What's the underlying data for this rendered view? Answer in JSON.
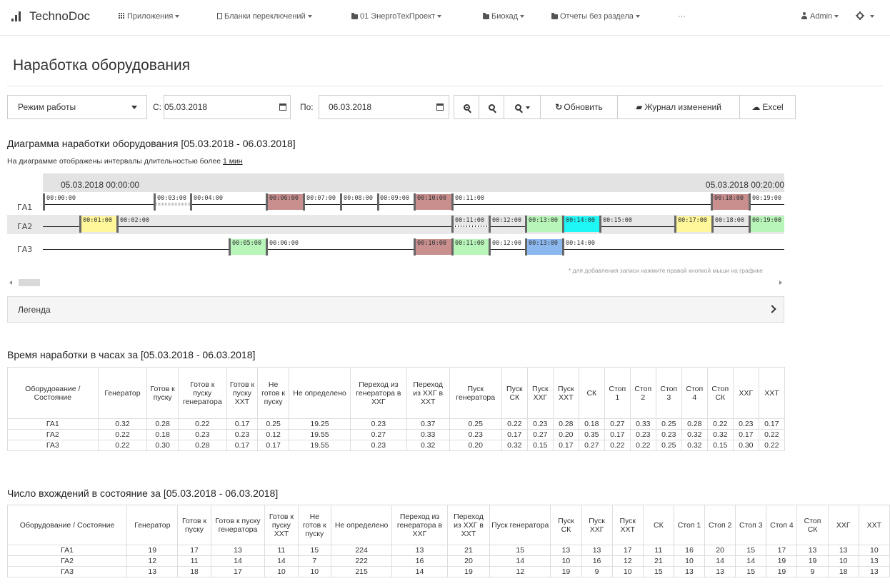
{
  "app": {
    "brand": "TechnoDoc",
    "nav": [
      {
        "label": "Приложения",
        "icon": "grid-icon"
      },
      {
        "label": "Бланки переключений",
        "icon": "document-icon"
      },
      {
        "label": "01 ЭнергоТехПроект",
        "icon": "folder-icon"
      },
      {
        "label": "Биокад",
        "icon": "folder-icon"
      },
      {
        "label": "Отчеты без раздела",
        "icon": "folder-icon"
      },
      {
        "label": "···",
        "icon": ""
      }
    ],
    "user": "Admin"
  },
  "page": {
    "title": "Наработка оборудования"
  },
  "toolbar": {
    "mode_select": "Режим работы",
    "from_label": "С:",
    "from_value": "05.03.2018",
    "to_label": "По:",
    "to_value": "06.03.2018",
    "refresh": "Обновить",
    "changelog": "Журнал изменений",
    "excel": "Excel"
  },
  "diagram": {
    "title": "Диаграмма наработки оборудования [05.03.2018 - 06.03.2018]",
    "note_prefix": "На диаграмме отображены интервалы длительностью более ",
    "note_link": "1 мин",
    "range_start": "05.03.2018 00:00:00",
    "range_end": "05.03.2018 00:20:00",
    "hint": "* для добавления записи нажмите правой кнопкой мыши на графике",
    "rows": [
      {
        "label": "ГА1"
      },
      {
        "label": "ГА2"
      },
      {
        "label": "ГА3"
      }
    ],
    "times": {
      "r1": [
        "00:00:00",
        "00:03:00",
        "00:04:00",
        "00:06:00",
        "00:07:00",
        "00:08:00",
        "00:09:00",
        "00:10:00",
        "00:11:00",
        "00:18:00",
        "00:19:00"
      ],
      "r2": [
        "00:01:00",
        "00:02:00",
        "00:11:00",
        "00:12:00",
        "00:13:00",
        "00:14:00",
        "00:15:00",
        "00:17:00",
        "00:18:00",
        "00:19:00"
      ],
      "r3": [
        "00:05:00",
        "00:06:00",
        "00:10:00",
        "00:11:00",
        "00:12:00",
        "00:13:00",
        "00:14:00"
      ]
    },
    "colors": {
      "red": "#c98f8f",
      "yellow": "#fff79a",
      "green": "#b8f5b8",
      "cyan": "#1ff7f7",
      "blue": "#8cb8f0"
    }
  },
  "legend": {
    "label": "Легенда"
  },
  "hours_table": {
    "title": "Время наработки в часах за [05.03.2018 - 06.03.2018]",
    "headers": [
      "Оборудование / Состояние",
      "Генератор",
      "Готов к пуску",
      "Готов к пуску генератора",
      "Готов к пуску ХХТ",
      "Не готов к пуску",
      "Не определено",
      "Переход из генератора в ХХГ",
      "Переход из ХХГ в ХХТ",
      "Пуск генератора",
      "Пуск СК",
      "Пуск ХХГ",
      "Пуск ХХТ",
      "СК",
      "Стоп 1",
      "Стоп 2",
      "Стоп 3",
      "Стоп 4",
      "Стоп СК",
      "ХХГ",
      "ХХТ"
    ],
    "rows": [
      [
        "ГА1",
        "0.32",
        "0.28",
        "0.22",
        "0.17",
        "0.25",
        "19.25",
        "0.23",
        "0.37",
        "0.25",
        "0.22",
        "0.23",
        "0.28",
        "0.18",
        "0.27",
        "0.33",
        "0.25",
        "0.28",
        "0.22",
        "0.23",
        "0.17"
      ],
      [
        "ГА2",
        "0.22",
        "0.18",
        "0.23",
        "0.23",
        "0.12",
        "19.55",
        "0.27",
        "0.33",
        "0.23",
        "0.17",
        "0.27",
        "0.20",
        "0.35",
        "0.17",
        "0.23",
        "0.23",
        "0.32",
        "0.32",
        "0.17",
        "0.22"
      ],
      [
        "ГА3",
        "0.22",
        "0.30",
        "0.28",
        "0.17",
        "0.17",
        "19.55",
        "0.23",
        "0.32",
        "0.20",
        "0.32",
        "0.15",
        "0.17",
        "0.27",
        "0.22",
        "0.22",
        "0.25",
        "0.32",
        "0.15",
        "0.30",
        "0.22"
      ]
    ]
  },
  "count_table": {
    "title": "Число вхождений в состояние за [05.03.2018 - 06.03.2018]",
    "headers": [
      "Оборудование / Состояние",
      "Генератор",
      "Готов к пуску",
      "Готов к пуску генератора",
      "Готов к пуску ХХТ",
      "Не готов к пуску",
      "Не определено",
      "Переход из генератора в ХХГ",
      "Переход из ХХГ в ХХТ",
      "Пуск генератора",
      "Пуск СК",
      "Пуск ХХГ",
      "Пуск ХХТ",
      "СК",
      "Стоп 1",
      "Стоп 2",
      "Стоп 3",
      "Стоп 4",
      "Стоп СК",
      "ХХГ",
      "ХХТ"
    ],
    "rows": [
      [
        "ГА1",
        "19",
        "17",
        "13",
        "11",
        "15",
        "224",
        "13",
        "21",
        "15",
        "13",
        "13",
        "17",
        "11",
        "16",
        "20",
        "15",
        "17",
        "13",
        "13",
        "10"
      ],
      [
        "ГА2",
        "12",
        "11",
        "14",
        "14",
        "7",
        "222",
        "16",
        "20",
        "14",
        "10",
        "16",
        "12",
        "21",
        "10",
        "14",
        "14",
        "19",
        "19",
        "10",
        "13"
      ],
      [
        "ГА3",
        "13",
        "18",
        "17",
        "10",
        "10",
        "215",
        "14",
        "19",
        "12",
        "19",
        "9",
        "10",
        "15",
        "13",
        "13",
        "15",
        "19",
        "9",
        "18",
        "13"
      ]
    ]
  }
}
